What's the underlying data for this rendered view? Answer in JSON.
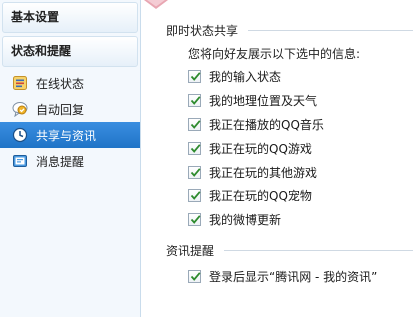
{
  "sidebar": {
    "section_basic": "基本设置",
    "section_status": "状态和提醒",
    "items": [
      {
        "label": "在线状态",
        "icon": "online-status-icon"
      },
      {
        "label": "自动回复",
        "icon": "auto-reply-icon"
      },
      {
        "label": "共享与资讯",
        "icon": "clock-icon",
        "active": true
      },
      {
        "label": "消息提醒",
        "icon": "message-reminder-icon"
      }
    ]
  },
  "main": {
    "share_group": {
      "title": "即时状态共享",
      "description": "您将向好友展示以下选中的信息:",
      "options": [
        {
          "label": "我的输入状态",
          "checked": true
        },
        {
          "label": "我的地理位置及天气",
          "checked": true
        },
        {
          "label": "我正在播放的QQ音乐",
          "checked": true
        },
        {
          "label": "我正在玩的QQ游戏",
          "checked": true
        },
        {
          "label": "我正在玩的其他游戏",
          "checked": true
        },
        {
          "label": "我正在玩的QQ宠物",
          "checked": true
        },
        {
          "label": "我的微博更新",
          "checked": true
        }
      ]
    },
    "news_group": {
      "title": "资讯提醒",
      "options": [
        {
          "label": "登录后显示“腾讯网 - 我的资讯”",
          "checked": true
        }
      ]
    }
  },
  "colors": {
    "active_item_bg": "#2a80d6",
    "checkmark": "#2e8b2e",
    "sidebar_bg": "#f3f8fd"
  }
}
